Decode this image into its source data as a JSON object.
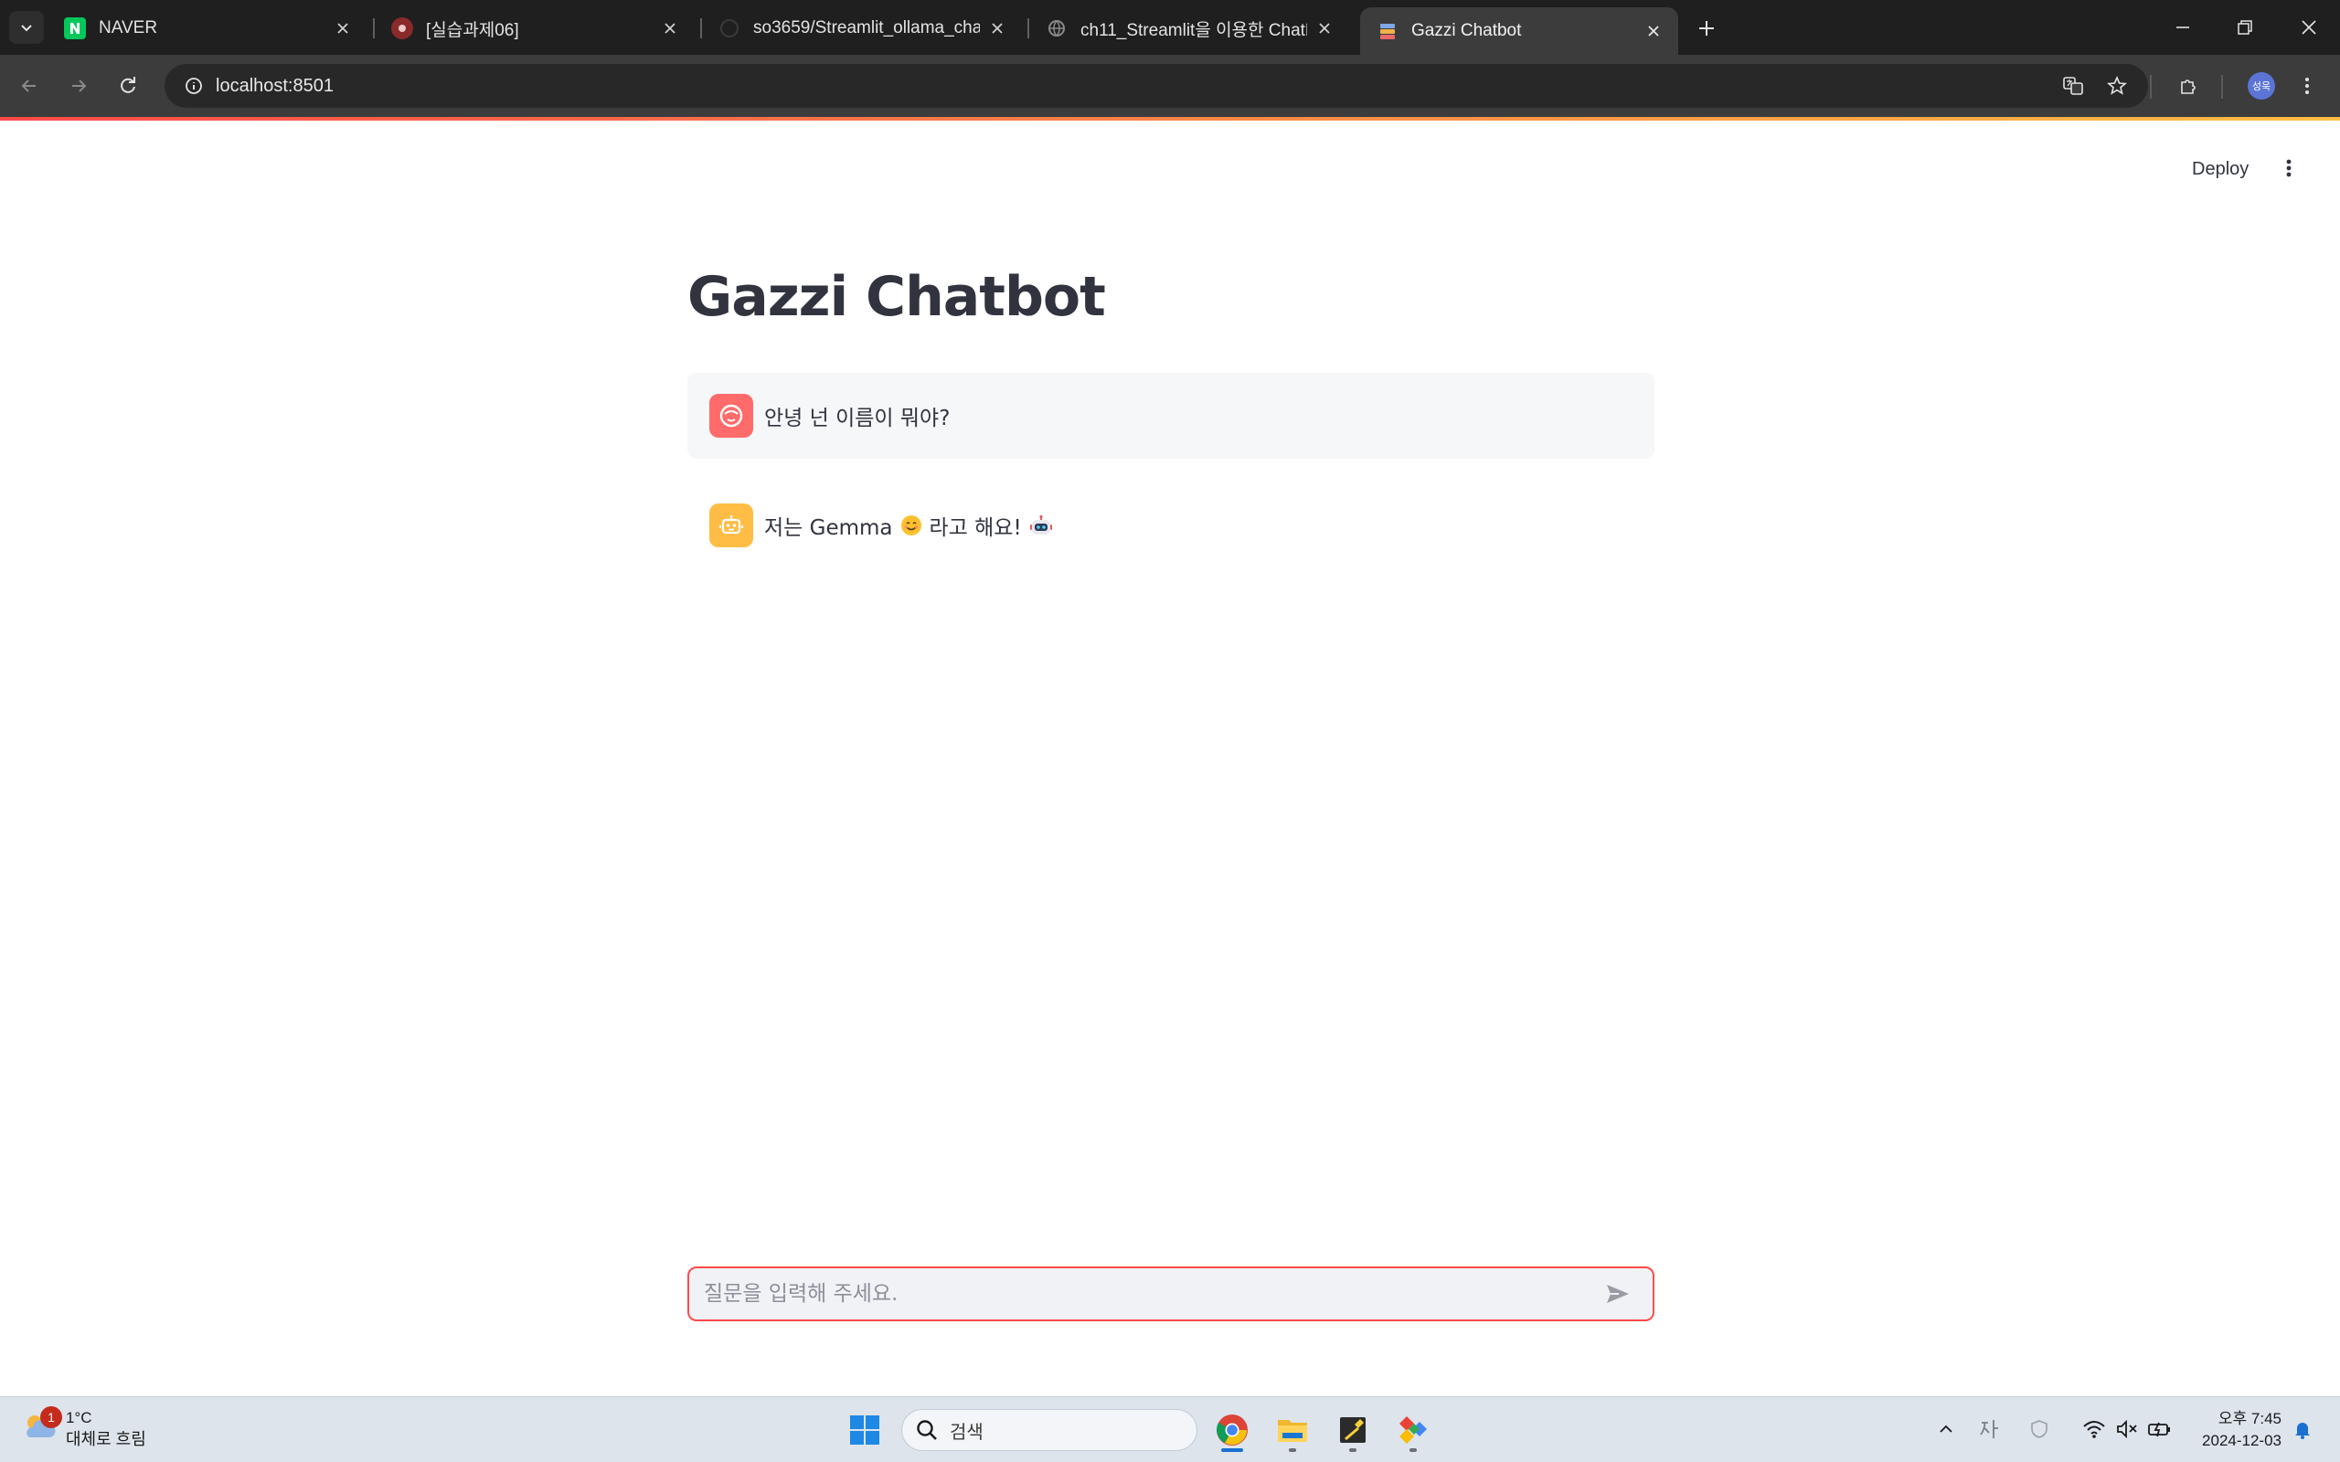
{
  "browser": {
    "tabs": [
      {
        "title": "NAVER"
      },
      {
        "title": "[실습과제06]"
      },
      {
        "title": "so3659/Streamlit_ollama_chatb"
      },
      {
        "title": "ch11_Streamlit을 이용한 ChatB"
      },
      {
        "title": "Gazzi Chatbot"
      }
    ],
    "url": "localhost:8501",
    "profile_initials": "성욱"
  },
  "app": {
    "deploy_label": "Deploy",
    "title": "Gazzi Chatbot",
    "messages": [
      {
        "role": "user",
        "text": "안녕 넌 이름이 뭐야?"
      },
      {
        "role": "assistant",
        "text_before": "저는 Gemma",
        "text_after": "라고 해요!"
      }
    ],
    "chat_input_placeholder": "질문을 입력해 주세요."
  },
  "taskbar": {
    "weather_badge": "1",
    "temperature": "1°C",
    "weather_condition": "대체로 흐림",
    "search_label": "검색",
    "time": "오후 7:45",
    "date": "2024-12-03"
  },
  "colors": {
    "accent": "#ff4b4b",
    "user_avatar": "#ff6b6b",
    "assistant_avatar": "#ffbd45",
    "text": "#31333f"
  }
}
